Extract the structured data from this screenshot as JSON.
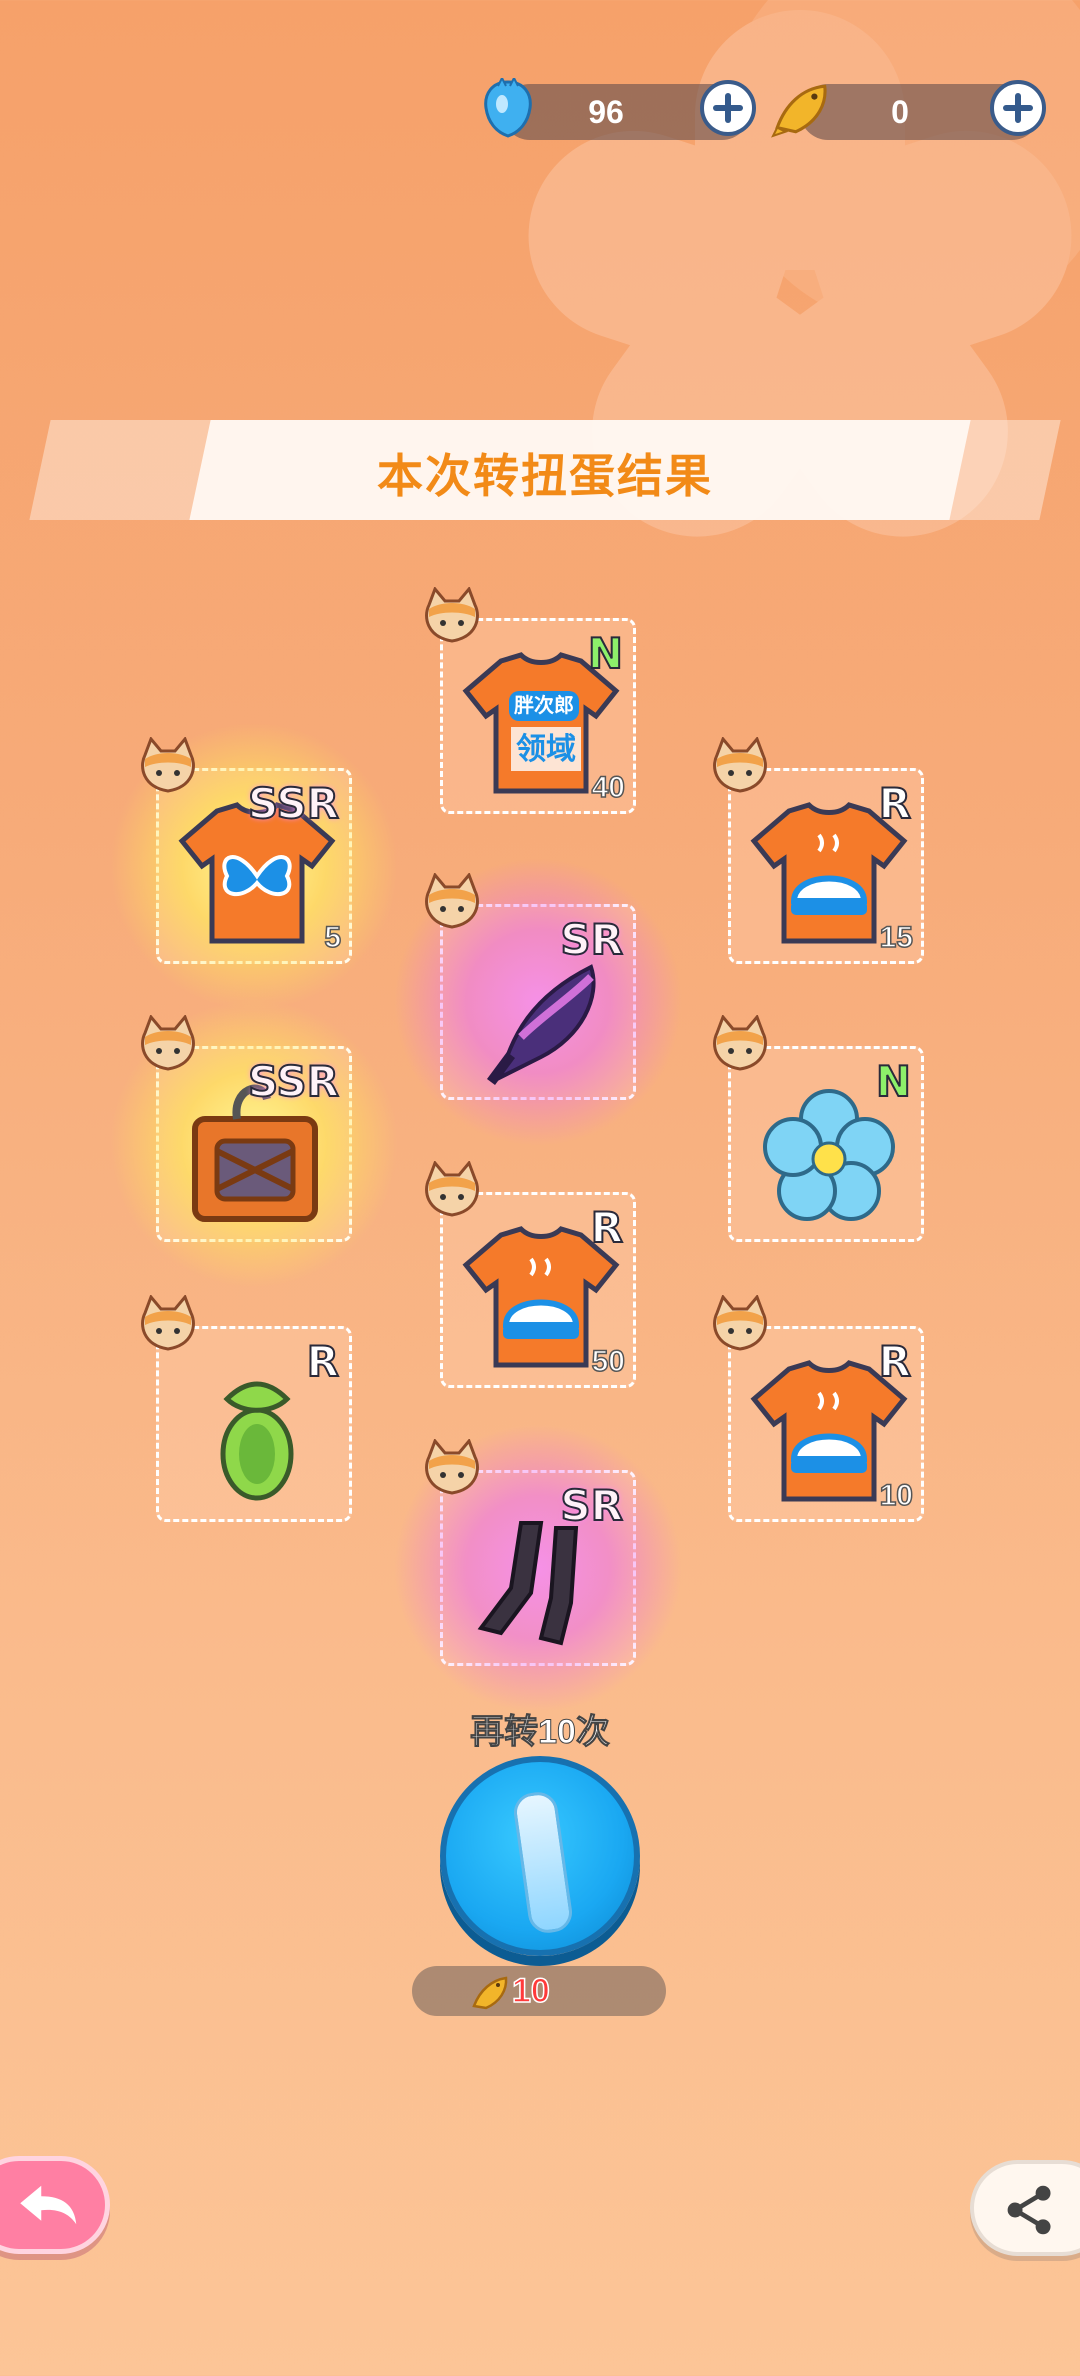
{
  "currencies": [
    {
      "name": "blue-gem",
      "value": "96",
      "color": "#3fb0f0"
    },
    {
      "name": "gold-fish",
      "value": "0",
      "color": "#f2b52a"
    }
  ],
  "header": {
    "title": "本次转扭蛋结果"
  },
  "items": [
    {
      "rarity": "N",
      "quantity": "40",
      "icon": "tshirt-lingyu-icon",
      "color": "#8df06a"
    },
    {
      "rarity": "SSR",
      "quantity": "5",
      "icon": "butterfly-tshirt-icon",
      "color": "#ffe35a"
    },
    {
      "rarity": "R",
      "quantity": "15",
      "icon": "bun-tshirt-icon"
    },
    {
      "rarity": "SR",
      "quantity": "",
      "icon": "witch-hat-icon",
      "color": "#f08cf0"
    },
    {
      "rarity": "SSR",
      "quantity": "",
      "icon": "treasure-crate-icon",
      "color": "#ffe35a"
    },
    {
      "rarity": "N",
      "quantity": "",
      "icon": "blue-flower-icon",
      "color": "#8df06a"
    },
    {
      "rarity": "R",
      "quantity": "50",
      "icon": "bun-tshirt-icon"
    },
    {
      "rarity": "R",
      "quantity": "",
      "icon": "green-bow-icon"
    },
    {
      "rarity": "R",
      "quantity": "10",
      "icon": "bun-tshirt-icon"
    },
    {
      "rarity": "SR",
      "quantity": "",
      "icon": "black-stockings-icon",
      "color": "#f08cf0"
    }
  ],
  "spin": {
    "label": "再转10次",
    "cost": "10"
  },
  "colors": {
    "background": "#f7ab79",
    "accent": "#f28a17",
    "spin_button": "#1aa8f2",
    "back_button": "#ff7fa3"
  }
}
